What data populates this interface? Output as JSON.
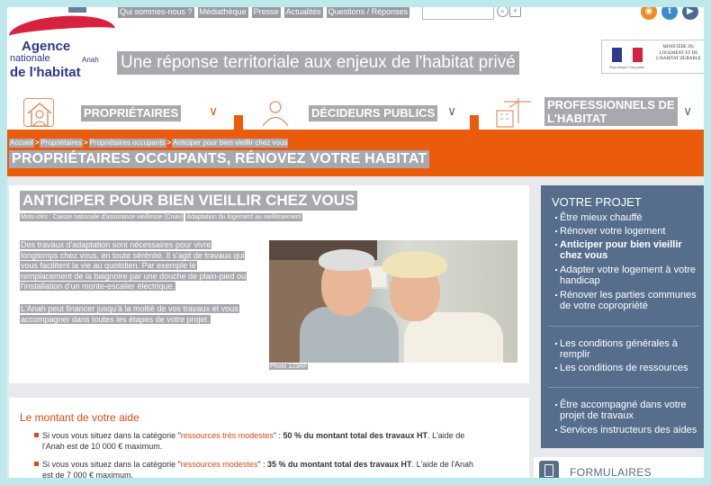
{
  "topnav": [
    "Qui sommes-nous ?",
    "Médiathèque",
    "Presse",
    "Actualités",
    "Questions / Réponses"
  ],
  "search": {
    "placeholder": ""
  },
  "logo": {
    "line1": "Agence",
    "line2": "nationale",
    "line3": "de l'habitat",
    "anah": "Anah"
  },
  "tagline": "Une réponse territoriale aux enjeux de l'habitat privé",
  "ministry": {
    "text": "MINISTÈRE DU LOGEMENT ET DE L'HABITAT DURABLE",
    "rf": "République Française"
  },
  "nav": [
    {
      "label": "PROPRIÉTAIRES",
      "chevron": "∨"
    },
    {
      "label": "DÉCIDEURS PUBLICS",
      "chevron": "∨"
    },
    {
      "label": "PROFESSIONNELS DE L'HABITAT",
      "line1": "PROFESSIONNELS DE",
      "line2": "L'HABITAT",
      "chevron": "∨"
    }
  ],
  "breadcrumb": [
    "Accueil",
    "Propriétaires",
    "Propriétaires occupants",
    "Anticiper pour bien vieillir chez vous"
  ],
  "breadcrumb_sep": ">",
  "page_title": "PROPRIÉTAIRES OCCUPANTS, RÉNOVEZ VOTRE HABITAT",
  "article": {
    "title": "ANTICIPER POUR BIEN VIEILLIR CHEZ VOUS",
    "keywords_label": "Mots-clés : Caisse nationale d'assurance vieillesse (Cnav)",
    "keyword2": "Adaptation du logement au vieillissement",
    "para1": [
      "Des travaux d'adaptation sont nécessaires pour vivre",
      "longtemps chez vous, en toute sérénité. Il s'agit de travaux qui",
      "vous facilitent la vie au quotidien. Par exemple le",
      "remplacement de la baignoire par une douche de plain-pied ou",
      "l'installation d'un monte-escalier électrique."
    ],
    "para2": [
      "L'Anah peut financer jusqu'à la moitié de vos travaux et vous",
      "accompagner dans toutes les étapes de votre projet."
    ],
    "photo_credit": "Photo 123RF"
  },
  "aide": {
    "title": "Le montant de votre aide",
    "items": [
      {
        "pre": "Si vous vous situez dans la catégorie \"",
        "link": "ressources très modestes",
        "mid": "\" : ",
        "bold": "50 % du montant total des travaux HT",
        "post": ". L'aide de",
        "line2": "l'Anah est de 10 000 € maximum."
      },
      {
        "pre": "Si vous vous situez dans la catégorie \"",
        "link": "ressources modestes",
        "mid": "\" : ",
        "bold": "35 % du montant total des travaux HT",
        "post": ". L'aide de l'Anah",
        "line2": "est de 7 000 € maximum."
      }
    ]
  },
  "sidebar": {
    "title": "VOTRE PROJET",
    "group1": [
      "Être mieux chauffé",
      "Rénover votre logement",
      "Anticiper pour bien vieillir chez vous",
      "Adapter votre logement à votre handicap",
      "Rénover les parties communes de votre copropriété"
    ],
    "group2": [
      "Les conditions générales à remplir",
      "Les conditions de ressources"
    ],
    "group3": [
      "Être accompagné dans votre projet de travaux",
      "Services instructeurs des aides"
    ],
    "forms": "FORMULAIRES"
  },
  "colors": {
    "accent": "#ea5b0c",
    "sidebar": "#566e8c",
    "brand_red": "#d8213f",
    "brand_blue": "#2b3a8a"
  }
}
